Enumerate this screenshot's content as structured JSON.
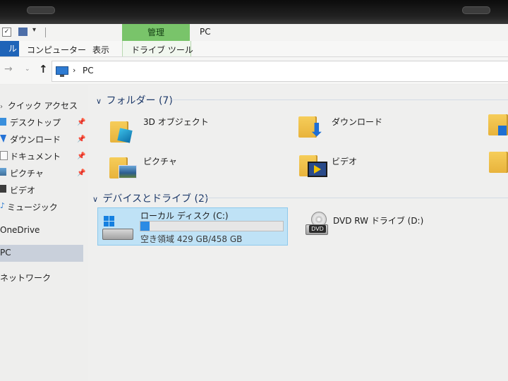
{
  "quick_access_toolbar": {
    "customize_glyph": "▾"
  },
  "ribbon": {
    "contextual_group": "管理",
    "window_title": "PC",
    "file_tab": "ル",
    "tabs": [
      "コンピューター",
      "表示",
      "ドライブ ツール"
    ]
  },
  "address_bar": {
    "path_sep": "›",
    "path": "PC"
  },
  "nav_pane": {
    "items": [
      {
        "label": "クイック アクセス"
      },
      {
        "label": "デスクトップ",
        "pinned": true
      },
      {
        "label": "ダウンロード",
        "pinned": true
      },
      {
        "label": "ドキュメント",
        "pinned": true
      },
      {
        "label": "ピクチャ",
        "pinned": true
      },
      {
        "label": "ビデオ"
      },
      {
        "label": "ミュージック"
      },
      {
        "label": "OneDrive"
      },
      {
        "label": "PC",
        "selected": true
      },
      {
        "label": "ネットワーク"
      }
    ]
  },
  "content": {
    "folders_header": "フォルダー (7)",
    "folders": [
      {
        "label": "3D オブジェクト",
        "icon": "3d-objects-icon"
      },
      {
        "label": "ダウンロード",
        "icon": "downloads-icon"
      },
      {
        "label": "ピクチャ",
        "icon": "pictures-icon"
      },
      {
        "label": "ビデオ",
        "icon": "videos-icon"
      }
    ],
    "devices_header": "デバイスとドライブ (2)",
    "drives": [
      {
        "label": "ローカル ディスク (C:)",
        "free_text": "空き領域 429 GB/458 GB",
        "used_fraction": 0.064,
        "selected": true
      },
      {
        "label": "DVD RW ドライブ (D:)",
        "icon_text": "DVD"
      }
    ]
  },
  "colors": {
    "accent": "#1f64b8",
    "manage_tab": "#79c46a",
    "selection": "#bfe2f6",
    "capacity_bar": "#2b8be4"
  }
}
